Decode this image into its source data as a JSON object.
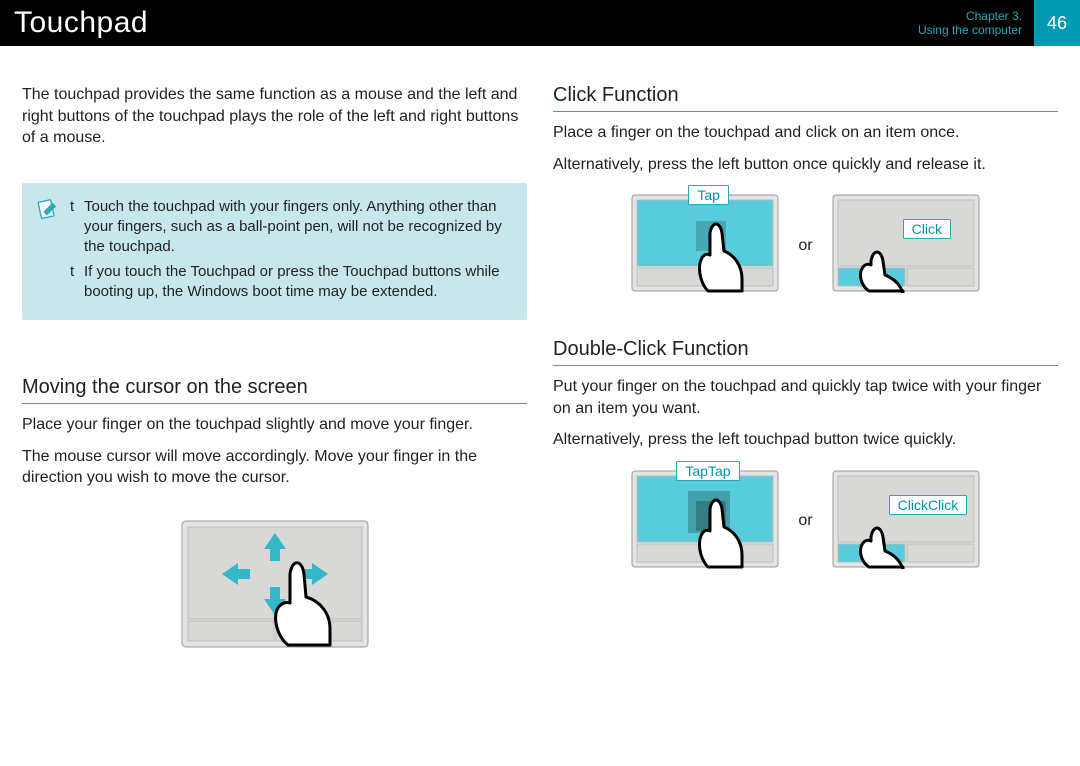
{
  "header": {
    "title": "Touchpad",
    "chapter_line1": "Chapter 3.",
    "chapter_line2": "Using the computer",
    "page_number": "46"
  },
  "left": {
    "intro": "The touchpad provides the same function as a mouse and the left and right buttons of the touchpad plays the role of the left and right buttons of a mouse.",
    "note_items": [
      "Touch the touchpad with your fingers only. Anything other than your fingers, such as a ball-point pen, will not be recognized by the touchpad.",
      "If you touch the Touchpad or press the Touchpad buttons while booting up, the Windows boot time may be extended."
    ],
    "section1": {
      "heading": "Moving the cursor on the screen",
      "p1": "Place your finger on the touchpad slightly and move your finger.",
      "p2": "The mouse cursor will move accordingly. Move your finger in the direction you wish to move the cursor."
    }
  },
  "right": {
    "section1": {
      "heading": "Click Function",
      "p1": "Place a finger on the touchpad and click on an item once.",
      "p2": "Alternatively, press the left button once quickly and release it.",
      "label_tap": "Tap",
      "label_click": "Click",
      "or": "or"
    },
    "section2": {
      "heading": "Double-Click Function",
      "p1": "Put your finger on the touchpad and quickly tap twice with your finger on an item you want.",
      "p2": "Alternatively, press the left touchpad button twice quickly.",
      "label_taptap": "TapTap",
      "label_clickclick": "ClickClick",
      "or": "or"
    }
  },
  "bullet_char": "t"
}
